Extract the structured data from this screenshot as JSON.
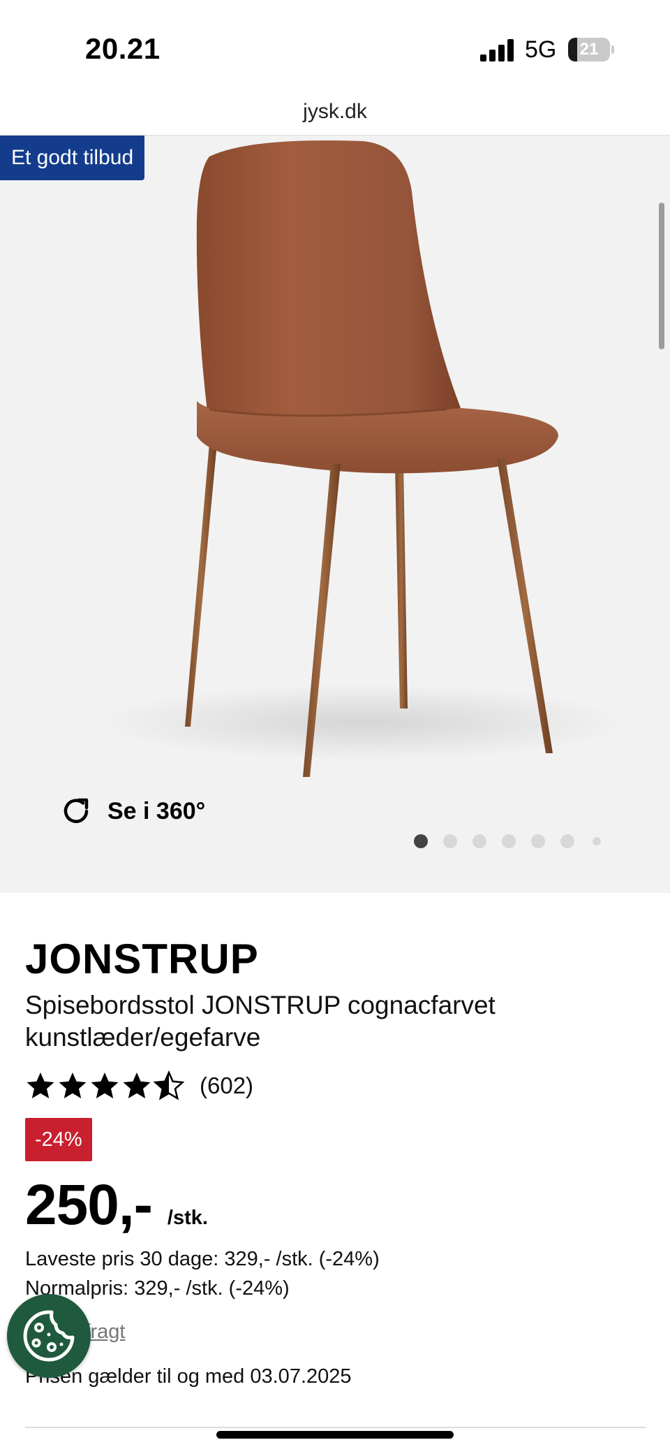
{
  "status_bar": {
    "time": "20.21",
    "network": "5G",
    "battery_percent": "21",
    "signal_bars": 4
  },
  "browser": {
    "url": "jysk.dk"
  },
  "gallery": {
    "offer_badge": "Et godt tilbud",
    "view_360_label": "Se i 360°",
    "image_count": 7,
    "active_image": 1
  },
  "product": {
    "brand": "JONSTRUP",
    "name": "Spisebordsstol JONSTRUP cognacfarvet kunstlæder/egefarve",
    "rating": 4.5,
    "review_count": "(602)",
    "discount_badge": "-24%",
    "price": "250,-",
    "unit": "/stk.",
    "lowest_price_30_days": "Laveste pris 30 dage: 329,- /stk. (-24%)",
    "normal_price": "Normalpris: 329,- /stk. (-24%)",
    "shipping_link": "Ekskl. fragt",
    "valid_until": "Prisen gælder til og med 03.07.2025"
  },
  "colors": {
    "offer_badge_bg": "#143c8c",
    "discount_badge_bg": "#c8202e",
    "cookie_button_bg": "#1f5a3e",
    "gallery_bg": "#f2f2f2"
  },
  "icons": {
    "rotate": "rotate-360-icon",
    "cookie": "cookie-icon",
    "star": "star-icon"
  }
}
